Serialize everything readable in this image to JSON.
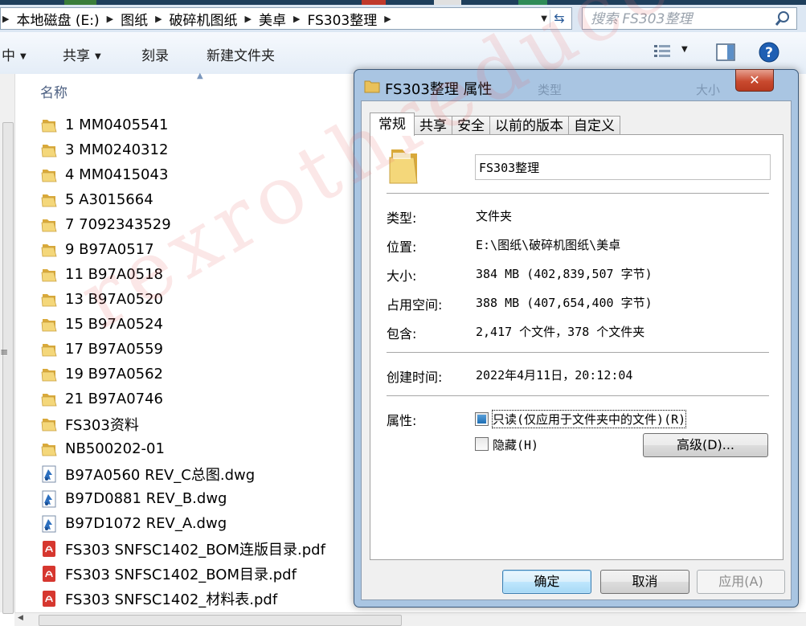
{
  "address": {
    "crumbs": [
      "本地磁盘 (E:)",
      "图纸",
      "破碎机图纸",
      "美卓",
      "FS303整理"
    ],
    "search_placeholder": "搜索 FS303整理"
  },
  "toolbar": {
    "organize_partial": "中",
    "share": "共享",
    "burn": "刻录",
    "new_folder": "新建文件夹"
  },
  "list": {
    "column_name": "名称",
    "files": [
      {
        "name": "1  MM0405541",
        "kind": "folder"
      },
      {
        "name": "3  MM0240312",
        "kind": "folder"
      },
      {
        "name": "4  MM0415043",
        "kind": "folder"
      },
      {
        "name": "5  A3015664",
        "kind": "folder"
      },
      {
        "name": "7  7092343529",
        "kind": "folder"
      },
      {
        "name": "9  B97A0517",
        "kind": "folder"
      },
      {
        "name": "11 B97A0518",
        "kind": "folder"
      },
      {
        "name": "13 B97A0520",
        "kind": "folder"
      },
      {
        "name": "15  B97A0524",
        "kind": "folder"
      },
      {
        "name": "17 B97A0559",
        "kind": "folder"
      },
      {
        "name": "19 B97A0562",
        "kind": "folder"
      },
      {
        "name": "21 B97A0746",
        "kind": "folder"
      },
      {
        "name": "FS303资料",
        "kind": "folder"
      },
      {
        "name": "NB500202-01",
        "kind": "folder"
      },
      {
        "name": "B97A0560 REV_C总图.dwg",
        "kind": "dwg"
      },
      {
        "name": "B97D0881 REV_B.dwg",
        "kind": "dwg"
      },
      {
        "name": "B97D1072 REV_A.dwg",
        "kind": "dwg"
      },
      {
        "name": "FS303 SNFSC1402_BOM连版目录.pdf",
        "kind": "pdf"
      },
      {
        "name": "FS303 SNFSC1402_BOM目录.pdf",
        "kind": "pdf"
      },
      {
        "name": "FS303 SNFSC1402_材料表.pdf",
        "kind": "pdf"
      }
    ]
  },
  "dialog": {
    "title": "FS303整理 属性",
    "ghost_type": "类型",
    "ghost_size": "大小",
    "close_symbol": "✕",
    "tabs": [
      "常规",
      "共享",
      "安全",
      "以前的版本",
      "自定义"
    ],
    "folder_name": "FS303整理",
    "props": [
      {
        "label": "类型:",
        "value": "文件夹"
      },
      {
        "label": "位置:",
        "value": "E:\\图纸\\破碎机图纸\\美卓"
      },
      {
        "label": "大小:",
        "value": "384 MB (402,839,507 字节)"
      },
      {
        "label": "占用空间:",
        "value": "388 MB (407,654,400 字节)"
      },
      {
        "label": "包含:",
        "value": "2,417 个文件，378 个文件夹"
      }
    ],
    "created_label": "创建时间:",
    "created_value": "2022年4月11日，20:12:04",
    "attr_label": "属性:",
    "readonly_label": "只读(仅应用于文件夹中的文件)(R)",
    "hidden_label": "隐藏(H)",
    "advanced_button": "高级(D)...",
    "ok_button": "确定",
    "cancel_button": "取消",
    "apply_button": "应用(A)"
  },
  "watermark": "rexrothreducer",
  "colors": {
    "accent": "#3c7fb1",
    "dialog_frame": "#a9c5e2",
    "close_red": "#c94a2f",
    "header_text": "#4d6082"
  }
}
